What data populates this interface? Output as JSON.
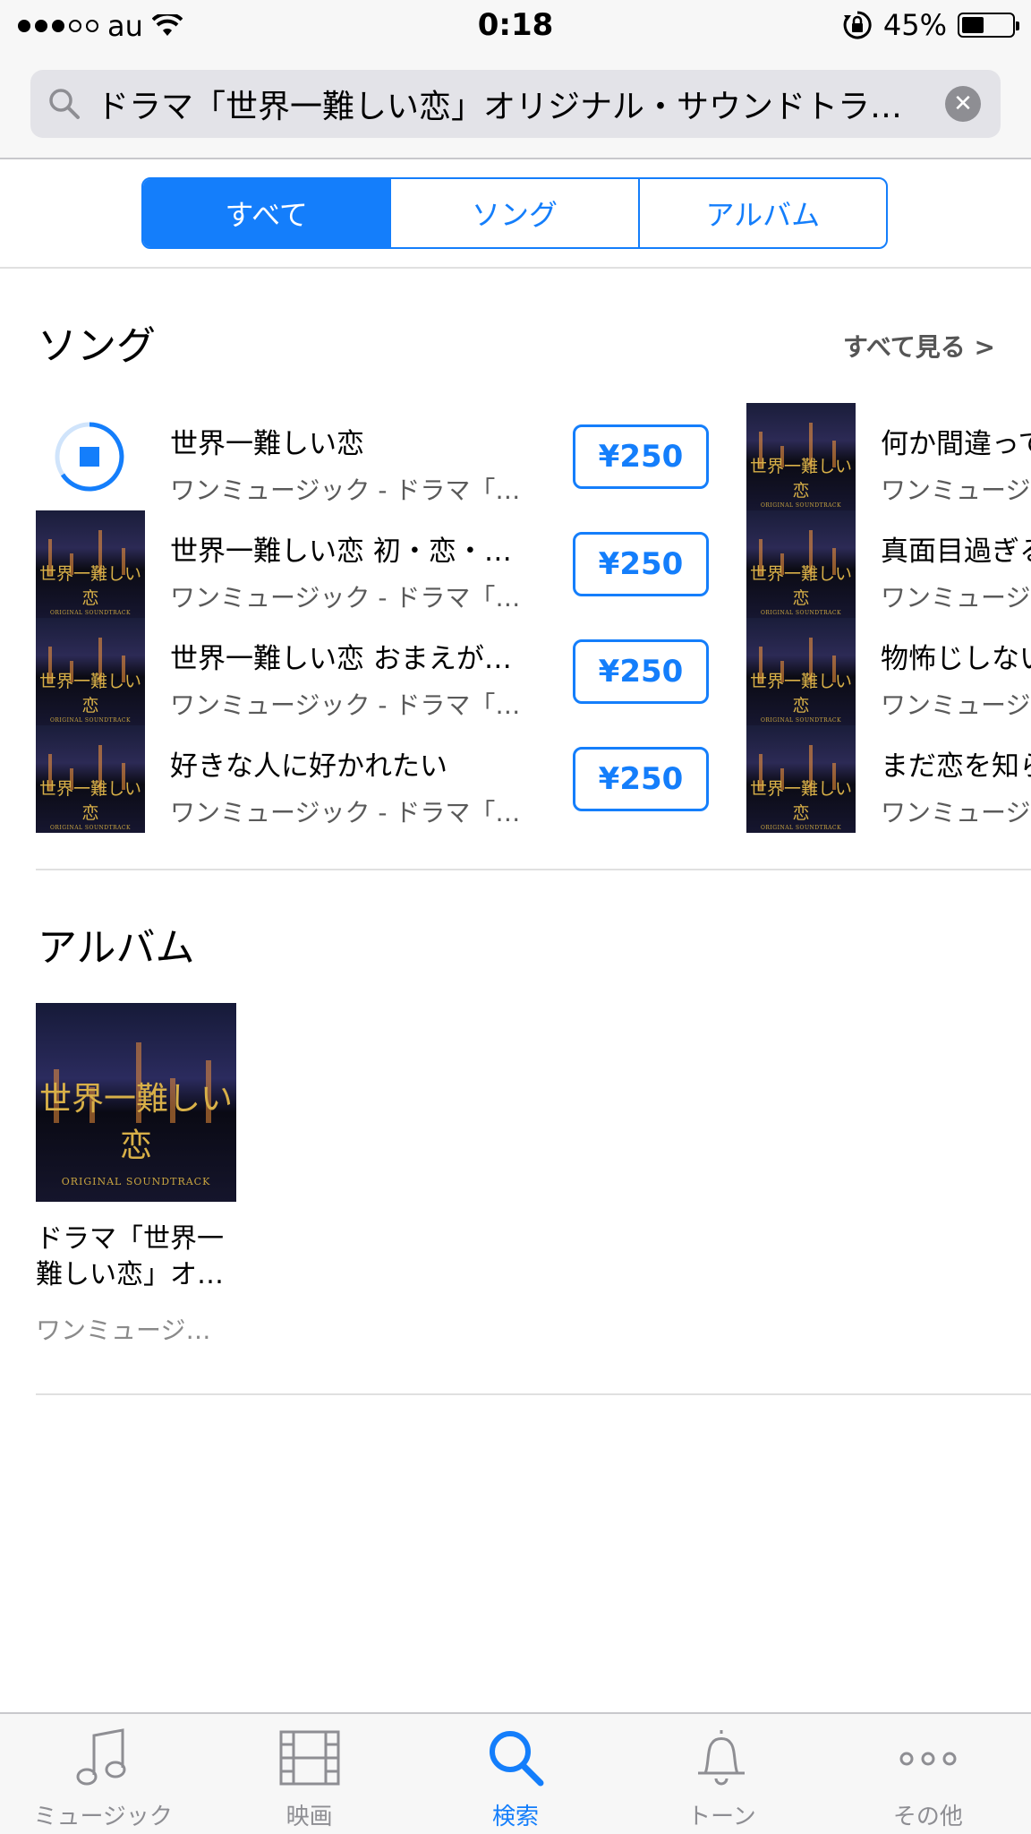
{
  "status_bar": {
    "carrier": "au",
    "time": "0:18",
    "battery_percent": "45%",
    "battery_level": 0.45,
    "signal_bars_filled": 3,
    "signal_bars_total": 5
  },
  "search": {
    "query": "ドラマ「世界一難しい恋」オリジナル・サウンドトラ…"
  },
  "segments": [
    {
      "label": "すべて",
      "active": true
    },
    {
      "label": "ソング",
      "active": false
    },
    {
      "label": "アルバム",
      "active": false
    }
  ],
  "songs_section": {
    "title": "ソング",
    "see_all": "すべて見る",
    "left_column": [
      {
        "title": "世界一難しい恋",
        "subtitle": "ワンミュージック - ドラマ「…",
        "price": "¥250",
        "downloading": true
      },
      {
        "title": "世界一難しい恋 初・恋・…",
        "subtitle": "ワンミュージック - ドラマ「…",
        "price": "¥250",
        "downloading": false
      },
      {
        "title": "世界一難しい恋 おまえが…",
        "subtitle": "ワンミュージック - ドラマ「…",
        "price": "¥250",
        "downloading": false
      },
      {
        "title": "好きな人に好かれたい",
        "subtitle": "ワンミュージック - ドラマ「…",
        "price": "¥250",
        "downloading": false
      }
    ],
    "right_column": [
      {
        "title": "何か間違って",
        "subtitle": "ワンミュージ"
      },
      {
        "title": "真面目過ぎる",
        "subtitle": "ワンミュージ"
      },
      {
        "title": "物怖じしない",
        "subtitle": "ワンミュージ"
      },
      {
        "title": "まだ恋を知ら",
        "subtitle": "ワンミュージ"
      }
    ],
    "artwork_text": "世界一難しい恋",
    "artwork_subtext": "ORIGINAL SOUNDTRACK"
  },
  "albums_section": {
    "title": "アルバム",
    "album": {
      "title": "ドラマ「世界一難しい恋」オ…",
      "artist": "ワンミュージ…",
      "artwork_text": "世界一難しい恋",
      "artwork_subtext": "ORIGINAL SOUNDTRACK"
    }
  },
  "tab_bar": [
    {
      "label": "ミュージック",
      "icon": "music-note-icon",
      "active": false
    },
    {
      "label": "映画",
      "icon": "film-icon",
      "active": false
    },
    {
      "label": "検索",
      "icon": "search-icon",
      "active": true
    },
    {
      "label": "トーン",
      "icon": "bell-icon",
      "active": false
    },
    {
      "label": "その他",
      "icon": "more-icon",
      "active": false
    }
  ],
  "colors": {
    "accent": "#147efb",
    "inactive_tab": "#8e8e93",
    "artwork_gold": "#d8b048"
  }
}
